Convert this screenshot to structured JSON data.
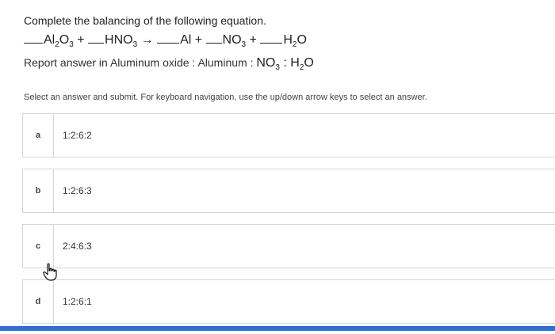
{
  "question": {
    "title": "Complete the balancing of the following equation.",
    "equation": {
      "term1": "Al",
      "term1_sub1": "2",
      "term1_mid": "O",
      "term1_sub2": "3",
      "plus1": " + ",
      "term2": "HNO",
      "term2_sub": "3",
      "arrow": " → ",
      "term3": "Al",
      "plus2": " + ",
      "term4": "NO",
      "term4_sub": "3",
      "plus3": " + ",
      "term5": "H",
      "term5_sub": "2",
      "term5_end": "O"
    },
    "report_prefix": "Report answer in Aluminum oxide : Aluminum : ",
    "report_no3": "NO",
    "report_no3_sub": "3",
    "report_sep": " : ",
    "report_h": "H",
    "report_h_sub": "2",
    "report_o": "O"
  },
  "instruction": "Select an answer and submit. For keyboard navigation, use the up/down arrow keys to select an answer.",
  "options": [
    {
      "letter": "a",
      "text": "1:2:6:2"
    },
    {
      "letter": "b",
      "text": "1:2:6:3"
    },
    {
      "letter": "c",
      "text": "2:4:6:3"
    },
    {
      "letter": "d",
      "text": "1:2:6:1"
    }
  ],
  "icons": {
    "cursor": "hand-pointer-icon"
  },
  "colors": {
    "accent_bar": "#2f6fd1",
    "option_border": "#d6d6d6"
  }
}
